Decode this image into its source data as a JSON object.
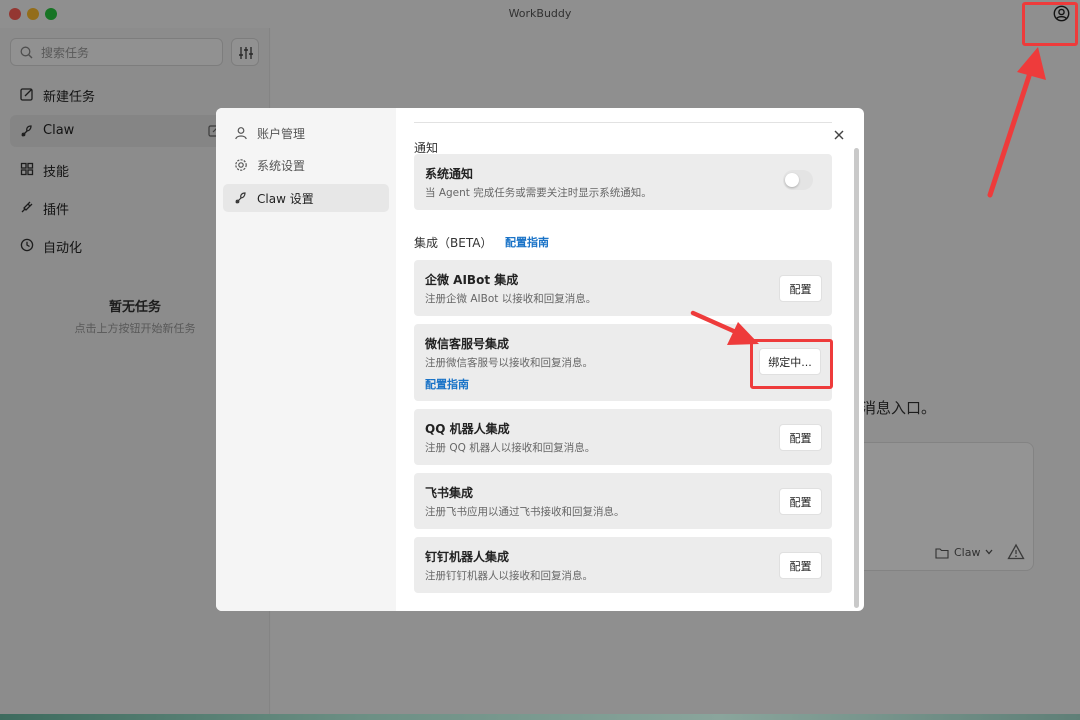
{
  "window": {
    "title": "WorkBuddy"
  },
  "sidebar": {
    "search_placeholder": "搜索任务",
    "items": [
      {
        "label": "新建任务",
        "icon": "edit-square-icon"
      },
      {
        "label": "Claw",
        "icon": "claw-icon"
      },
      {
        "label": "技能",
        "icon": "skills-icon"
      },
      {
        "label": "插件",
        "icon": "plugin-icon"
      },
      {
        "label": "自动化",
        "icon": "clock-icon"
      }
    ],
    "empty_title": "暂无任务",
    "empty_subtitle": "点击上方按钮开始新任务"
  },
  "main": {
    "hint_text": "消息入口。",
    "folder_label": "Claw"
  },
  "dialog": {
    "nav": [
      {
        "label": "账户管理",
        "icon": "user-icon"
      },
      {
        "label": "系统设置",
        "icon": "gear-icon"
      },
      {
        "label": "Claw 设置",
        "icon": "claw-icon"
      }
    ],
    "notification_section": "通知",
    "system_notice": {
      "title": "系统通知",
      "desc": "当 Agent 完成任务或需要关注时显示系统通知。",
      "enabled": false
    },
    "integration_section": "集成（BETA）",
    "integration_guide_link": "配置指南",
    "integrations": [
      {
        "title": "企微 AIBot 集成",
        "desc": "注册企微 AIBot 以接收和回复消息。",
        "button": "配置"
      },
      {
        "title": "微信客服号集成",
        "desc": "注册微信客服号以接收和回复消息。",
        "link": "配置指南",
        "button": "绑定中..."
      },
      {
        "title": "QQ 机器人集成",
        "desc": "注册 QQ 机器人以接收和回复消息。",
        "button": "配置"
      },
      {
        "title": "飞书集成",
        "desc": "注册飞书应用以通过飞书接收和回复消息。",
        "button": "配置"
      },
      {
        "title": "钉钉机器人集成",
        "desc": "注册钉钉机器人以接收和回复消息。",
        "button": "配置"
      }
    ]
  },
  "colors": {
    "link": "#1a73c7",
    "highlight": "#ee3b3b"
  }
}
